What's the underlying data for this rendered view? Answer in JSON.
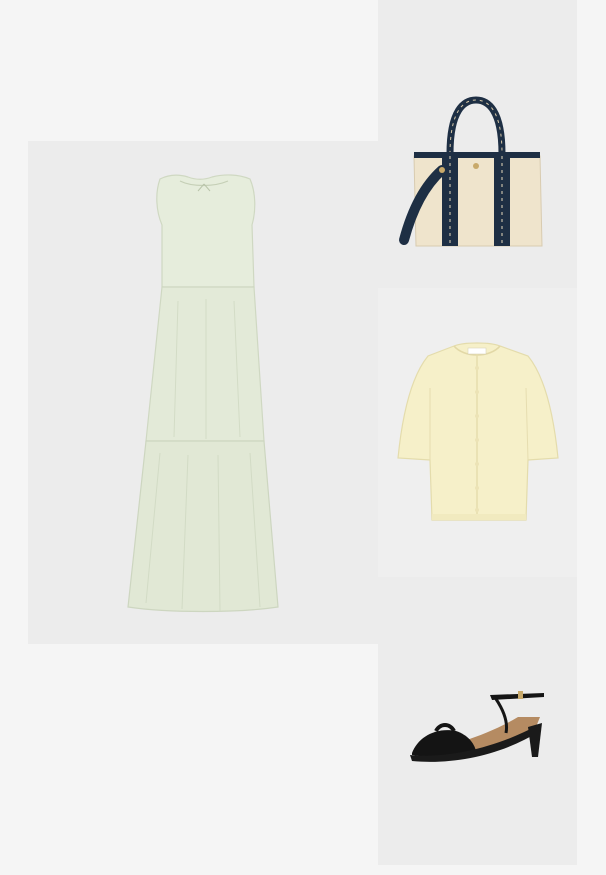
{
  "outfit": {
    "items": [
      {
        "name": "dress",
        "alt": "",
        "color": "#e2ead6"
      },
      {
        "name": "tote-bag",
        "alt": "",
        "color": "#1e2f44"
      },
      {
        "name": "cardigan",
        "alt": "",
        "color": "#f5efc6"
      },
      {
        "name": "sandal",
        "alt": "",
        "color": "#1a1a1a"
      }
    ],
    "colors": {
      "page_background": "#f5f5f5",
      "panel_background": "#ececec"
    }
  }
}
